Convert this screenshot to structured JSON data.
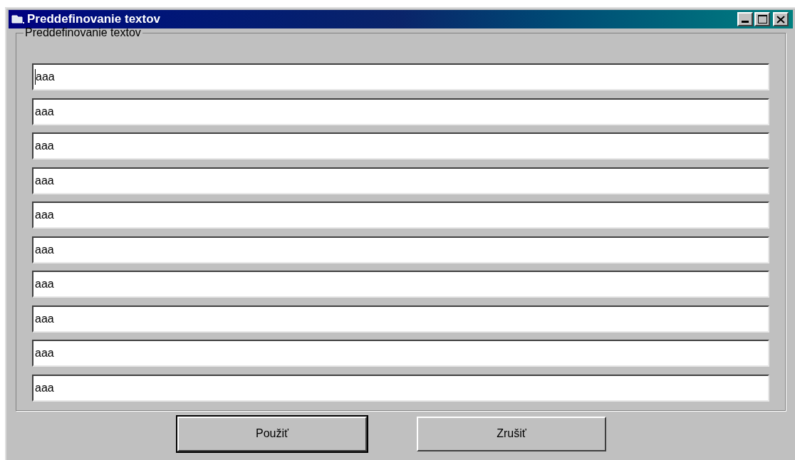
{
  "window": {
    "title": "Preddefinovanie textov"
  },
  "group": {
    "label": "Preddefinovanie textov",
    "fields": [
      {
        "value": "aaa",
        "focused": true
      },
      {
        "value": "aaa",
        "focused": false
      },
      {
        "value": "aaa",
        "focused": false
      },
      {
        "value": "aaa",
        "focused": false
      },
      {
        "value": "aaa",
        "focused": false
      },
      {
        "value": "aaa",
        "focused": false
      },
      {
        "value": "aaa",
        "focused": false
      },
      {
        "value": "aaa",
        "focused": false
      },
      {
        "value": "aaa",
        "focused": false
      },
      {
        "value": "aaa",
        "focused": false
      }
    ]
  },
  "buttons": [
    {
      "label": "Použiť",
      "default": true
    },
    {
      "label": "Zrušiť",
      "default": false
    }
  ]
}
